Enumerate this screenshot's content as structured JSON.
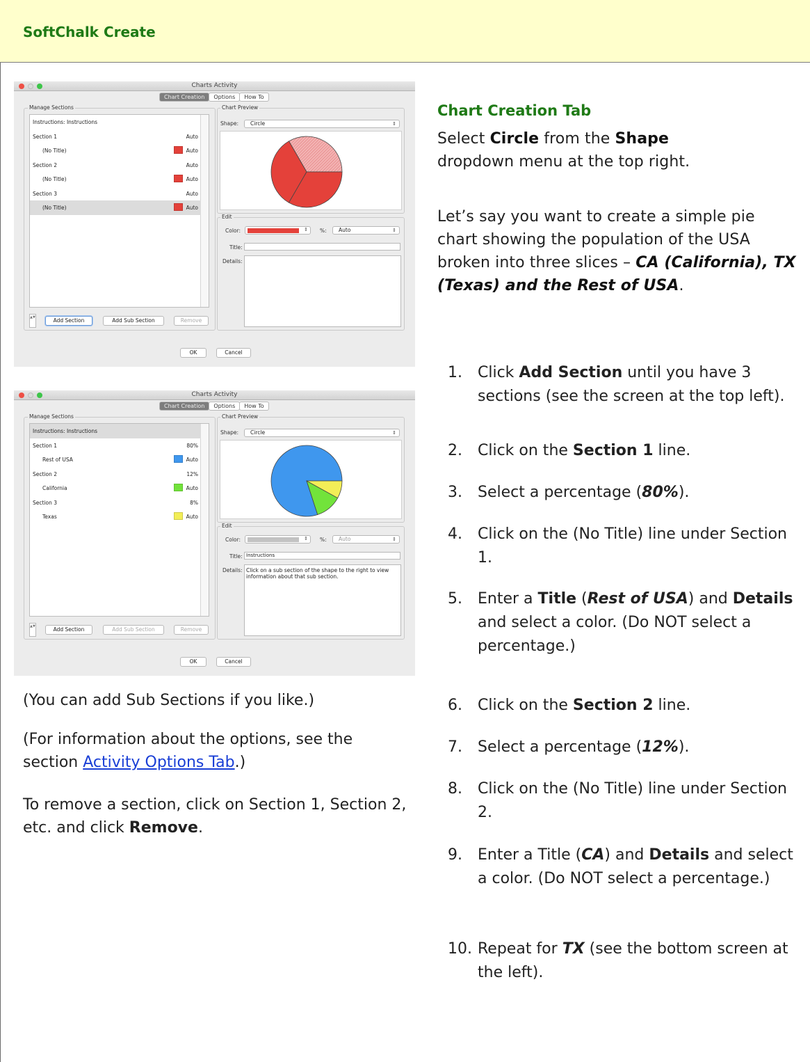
{
  "header": {
    "title": "SoftChalk Create"
  },
  "right": {
    "section_title": "Chart Creation Tab",
    "intro_parts": [
      "Select ",
      "Circle",
      " from the ",
      "Shape",
      " dropdown menu at the top right."
    ],
    "scenario_parts": [
      "Let’s say you want to create a simple pie chart showing the population of the USA broken into three slices – ",
      "CA (California), TX (Texas) and the Rest of USA",
      "."
    ],
    "steps": [
      {
        "num": "1.",
        "parts": [
          "Click ",
          "Add Section",
          " until you have 3 sections (see the screen at the top left)."
        ]
      },
      {
        "num": "2.",
        "parts": [
          "Click on the ",
          "Section 1",
          " line."
        ]
      },
      {
        "num": "3.",
        "parts": [
          "Select a percentage (",
          "80%",
          ")."
        ]
      },
      {
        "num": "4.",
        "parts": [
          "Click on the (No Title) line under Section 1."
        ]
      },
      {
        "num": "5.",
        "parts": [
          "Enter a ",
          "Title",
          " (",
          "Rest of USA",
          ") and ",
          "Details",
          " and select a color. (Do NOT select a percentage.)"
        ]
      },
      {
        "num": "6.",
        "parts": [
          "Click on the ",
          "Section 2",
          " line."
        ]
      },
      {
        "num": "7.",
        "parts": [
          "Select a percentage (",
          "12%",
          ")."
        ]
      },
      {
        "num": "8.",
        "parts": [
          "Click on the (No Title) line under Section 2."
        ]
      },
      {
        "num": "9.",
        "parts": [
          "Enter a Title (",
          "CA",
          ") and ",
          "Details",
          " and select a color. (Do NOT select a percentage.)"
        ]
      },
      {
        "num": "10.",
        "parts": [
          "Repeat for ",
          "TX",
          " (see the bottom screen at the left)."
        ]
      }
    ]
  },
  "left": {
    "note_sub": "(You can add Sub Sections if you like.)",
    "note_options_parts": [
      "(For information about the options, see the section ",
      "Activity Options Tab",
      ".)"
    ],
    "note_remove_parts": [
      "To remove a section, click on Section 1, Section 2, etc. and click ",
      "Remove",
      "."
    ]
  },
  "windows": [
    {
      "title": "Charts Activity",
      "tabs": [
        "Chart Creation",
        "Options",
        "How To"
      ],
      "active_tab": 0,
      "manage_label": "Manage Sections",
      "preview_label": "Chart Preview",
      "shape_label": "Shape:",
      "shape_value": "Circle",
      "edit_label": "Edit",
      "color_label": "Color:",
      "color_value": "#e4413a",
      "percent_label": "%:",
      "percent_value": "Auto",
      "title_label": "Title:",
      "title_value": "",
      "details_label": "Details:",
      "details_value": "",
      "rows": [
        {
          "label": "Instructions: Instructions",
          "value": "",
          "indent": false,
          "swatch": ""
        },
        {
          "label": "Section 1",
          "value": "Auto",
          "indent": false,
          "swatch": ""
        },
        {
          "label": "(No Title)",
          "value": "Auto",
          "indent": true,
          "swatch": "#e4413a"
        },
        {
          "label": "Section 2",
          "value": "Auto",
          "indent": false,
          "swatch": ""
        },
        {
          "label": "(No Title)",
          "value": "Auto",
          "indent": true,
          "swatch": "#e4413a"
        },
        {
          "label": "Section 3",
          "value": "Auto",
          "indent": false,
          "swatch": ""
        },
        {
          "label": "(No Title)",
          "value": "Auto",
          "indent": true,
          "swatch": "#e4413a"
        }
      ],
      "selected_row": 6,
      "buttons": {
        "add_section": "Add Section",
        "add_sub_section": "Add Sub Section",
        "remove": "Remove",
        "ok": "OK",
        "cancel": "Cancel"
      },
      "pie_slices": [
        {
          "fraction": 0.3333,
          "color": "#f19c9c",
          "hatched": true
        },
        {
          "fraction": 0.3333,
          "color": "#e4413a",
          "hatched": false
        },
        {
          "fraction": 0.3334,
          "color": "#e4413a",
          "hatched": false
        }
      ]
    },
    {
      "title": "Charts Activity",
      "tabs": [
        "Chart Creation",
        "Options",
        "How To"
      ],
      "active_tab": 0,
      "manage_label": "Manage Sections",
      "preview_label": "Chart Preview",
      "shape_label": "Shape:",
      "shape_value": "Circle",
      "edit_label": "Edit",
      "color_label": "Color:",
      "color_value": "#c2c2c2",
      "percent_label": "%:",
      "percent_value": "Auto",
      "title_label": "Title:",
      "title_value": "Instructions",
      "details_label": "Details:",
      "details_value": "Click on a sub section of the shape to the right to view information about that sub section.",
      "rows": [
        {
          "label": "Instructions: Instructions",
          "value": "",
          "indent": false,
          "swatch": ""
        },
        {
          "label": "Section 1",
          "value": "80%",
          "indent": false,
          "swatch": ""
        },
        {
          "label": "Rest of USA",
          "value": "Auto",
          "indent": true,
          "swatch": "#3f97ee"
        },
        {
          "label": "Section 2",
          "value": "12%",
          "indent": false,
          "swatch": ""
        },
        {
          "label": "California",
          "value": "Auto",
          "indent": true,
          "swatch": "#72e33b"
        },
        {
          "label": "Section 3",
          "value": "8%",
          "indent": false,
          "swatch": ""
        },
        {
          "label": "Texas",
          "value": "Auto",
          "indent": true,
          "swatch": "#f3ee57"
        }
      ],
      "selected_row": 0,
      "buttons": {
        "add_section": "Add Section",
        "add_sub_section": "Add Sub Section",
        "remove": "Remove",
        "ok": "OK",
        "cancel": "Cancel"
      },
      "pie_slices": [
        {
          "fraction": 0.8,
          "color": "#3f97ee",
          "hatched": false
        },
        {
          "fraction": 0.12,
          "color": "#72e33b",
          "hatched": false
        },
        {
          "fraction": 0.08,
          "color": "#f3ee57",
          "hatched": false
        }
      ]
    }
  ]
}
